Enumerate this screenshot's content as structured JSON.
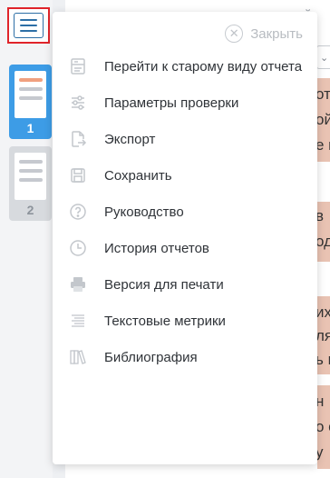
{
  "sidebar": {
    "pages": [
      {
        "number": "1",
        "active": true
      },
      {
        "number": "2",
        "active": false
      }
    ]
  },
  "menu": {
    "close_label": "Закрыть",
    "items": [
      {
        "label": "Перейти к старому виду отчета",
        "icon": "old-view-icon"
      },
      {
        "label": "Параметры проверки",
        "icon": "sliders-icon"
      },
      {
        "label": "Экспорт",
        "icon": "export-icon"
      },
      {
        "label": "Сохранить",
        "icon": "save-icon"
      },
      {
        "label": "Руководство",
        "icon": "help-icon"
      },
      {
        "label": "История отчетов",
        "icon": "history-icon"
      },
      {
        "label": "Версия для печати",
        "icon": "print-icon"
      },
      {
        "label": "Текстовые метрики",
        "icon": "text-metrics-icon"
      },
      {
        "label": "Библиография",
        "icon": "bibliography-icon"
      }
    ]
  },
  "background_doc": {
    "top_fragment": "й",
    "chevron": "⌄",
    "fragments": [
      "от",
      "ой",
      "е г",
      "в",
      "од",
      "их",
      "ля",
      "ь г",
      "н",
      "о с",
      "у"
    ]
  },
  "colors": {
    "accent_blue": "#3d9ce6",
    "highlight_red": "#e0242a",
    "doc_highlight": "#e9c3b3",
    "icon_gray": "#c3c7cc"
  }
}
